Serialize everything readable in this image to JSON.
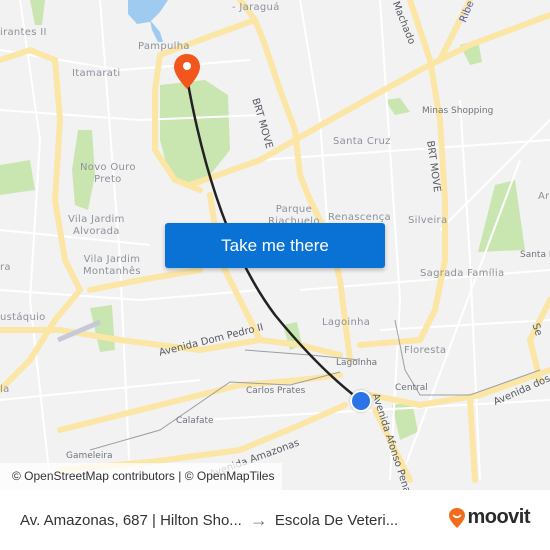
{
  "map": {
    "colors": {
      "background": "#f2f2f3",
      "major_road": "#fbe6a6",
      "minor_road": "#ffffff",
      "park": "#c9e6b0",
      "water": "#9fcbf0",
      "route_line": "#222222",
      "destination_pin": "#f2561d",
      "origin_dot": "#2b74e8"
    },
    "labels": {
      "jaragua": "- Jaraguá",
      "pampulha": "Pampulha",
      "itamarati": "Itamarati",
      "mirantes": "irantes II",
      "novo_ouro_preto": "Novo Ouro\nPreto",
      "vila_jardim_alvorada": "Vila Jardim\nAlvorada",
      "vila_jardim_montanhes": "Vila Jardim\nMontanhês",
      "eustaquio": "ustáquio",
      "santa_cruz": "Santa Cruz",
      "parque_riachuelo": "Parque\nRiachuelo",
      "renascenca": "Renascença",
      "silveira": "Silveira",
      "sagrada_familia": "Sagrada Família",
      "santa_ines": "Santa In",
      "lagoinha_district": "Lagoinha",
      "lagoinha_station": "Lagoinha",
      "floresta": "Floresta",
      "central": "Central",
      "carlos_prates": "Carlos Prates",
      "calafate": "Calafate",
      "gameleira": "Gameleira",
      "minas_shopping": "Minas Shopping",
      "an_partial": "Ar",
      "ra_partial": "ra",
      "la_partial": "la"
    },
    "roads": {
      "brt_move_north": "BRT MOVE",
      "brt_move_east": "BRT MOVE",
      "machado": "Machado",
      "ribeiro": "Ribe",
      "dom_pedro": "Avenida Dom Pedro II",
      "amazonas": "Avenida Amazonas",
      "afonso_pena": "Avenida Afonso Pena",
      "avenida_dos": "Avenida dos",
      "se_partial": "Se"
    }
  },
  "cta": {
    "label": "Take me there"
  },
  "attribution": {
    "text": "© OpenStreetMap contributors | © OpenMapTiles"
  },
  "footer": {
    "origin": "Av. Amazonas, 687 | Hilton Sho...",
    "arrow": "→",
    "destination": "Escola De Veteri...",
    "brand": "moovit",
    "brand_color": "#f26c1c"
  }
}
